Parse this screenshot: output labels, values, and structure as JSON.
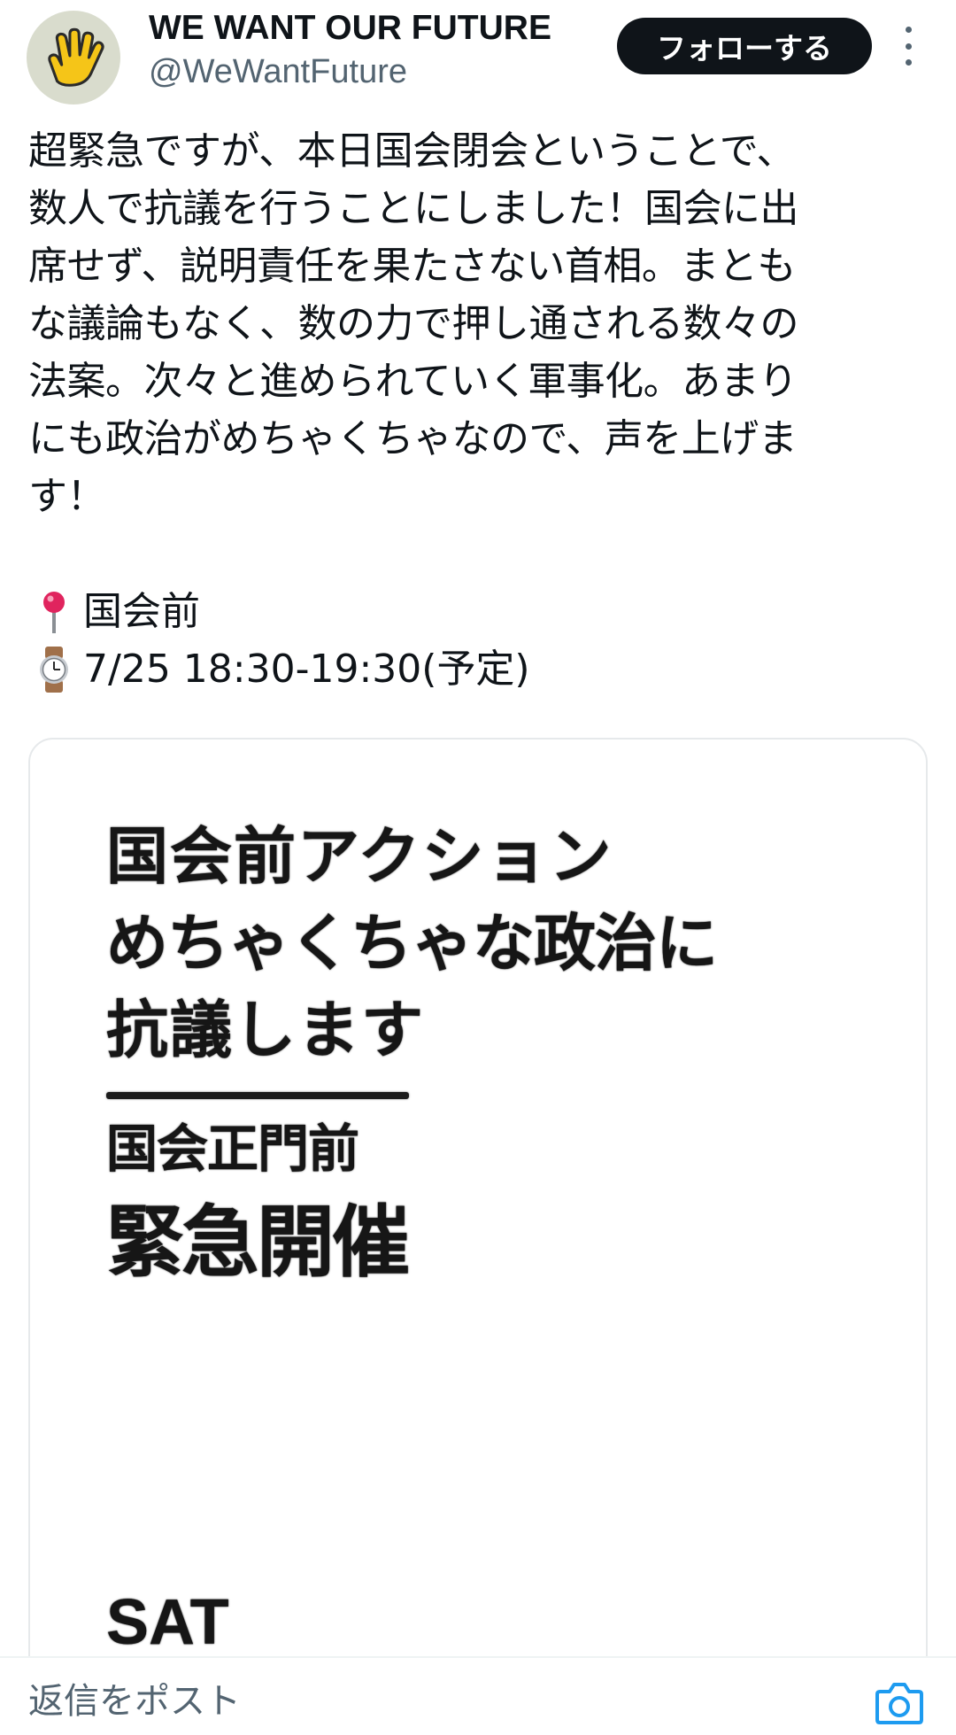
{
  "author": {
    "name": "WE WANT OUR FUTURE",
    "handle": "@WeWantFuture",
    "avatar_icon": "raised-hand-icon"
  },
  "actions": {
    "follow_label": "フォローする",
    "more_icon": "more-vertical-icon"
  },
  "post": {
    "text_lines": [
      "超緊急ですが、本日国会閉会ということで、",
      "数人で抗議を行うことにしました！国会に出",
      "席せず、説明責任を果たさない首相。まとも",
      "な議論もなく、数の力で押し通される数々の",
      "法案。次々と進められていく軍事化。あまり",
      "にも政治がめちゃくちゃなので、声を上げま",
      "す！"
    ],
    "location_icon": "pin-icon",
    "location": "国会前",
    "time_icon": "watch-icon",
    "time": "7/25 18:30-19:30(予定)"
  },
  "poster": {
    "line1": "国会前アクション",
    "line2": "めちゃくちゃな政治に",
    "line3": "抗議します",
    "line4": "国会正門前",
    "line5": "緊急開催",
    "day": "SAT"
  },
  "reply": {
    "placeholder": "返信をポスト",
    "camera_icon": "camera-icon"
  },
  "colors": {
    "text_primary": "#0f1419",
    "text_secondary": "#536471",
    "follow_bg": "#0f1419",
    "accent": "#1d9bf0",
    "avatar_bg": "#d9dccd",
    "hand_yellow": "#f5c518"
  }
}
